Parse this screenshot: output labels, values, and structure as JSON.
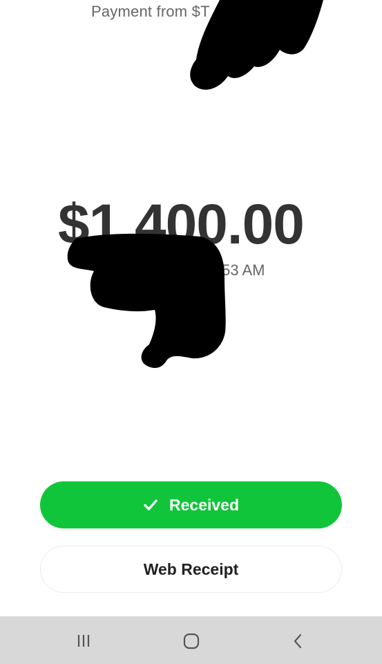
{
  "payment": {
    "from_text": "Payment from $T",
    "amount": "$1,400.00",
    "time_fragment": ":53 AM"
  },
  "actions": {
    "received_label": "Received",
    "web_receipt_label": "Web Receipt"
  },
  "icons": {
    "received": "checkmark-icon",
    "recents": "recent-apps-icon",
    "home": "home-icon",
    "back": "back-icon"
  },
  "colors": {
    "accent_green": "#10c53a",
    "text_dark": "#333333",
    "text_muted": "#666666",
    "nav_bar": "#d8d8d8",
    "redaction": "#000000"
  }
}
